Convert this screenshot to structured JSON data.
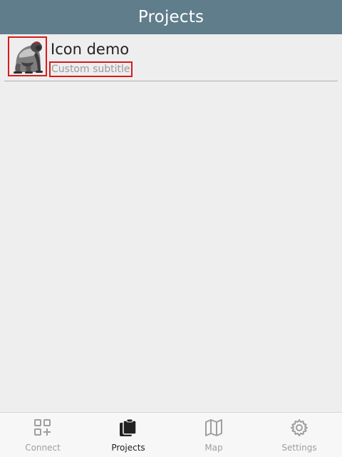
{
  "header": {
    "title": "Projects"
  },
  "projects": [
    {
      "title": "Icon demo",
      "subtitle": "Custom subtitle",
      "icon": "gorilla-icon"
    }
  ],
  "bottom_nav": {
    "items": [
      {
        "label": "Connect",
        "icon": "qr-connect-icon",
        "active": false
      },
      {
        "label": "Projects",
        "icon": "clipboard-icon",
        "active": true
      },
      {
        "label": "Map",
        "icon": "map-icon",
        "active": false
      },
      {
        "label": "Settings",
        "icon": "gear-icon",
        "active": false
      }
    ]
  },
  "colors": {
    "header_bg": "#607d8b",
    "highlight_border": "#d81b1b",
    "active_nav": "#212121",
    "inactive_nav": "#9e9e9e"
  }
}
